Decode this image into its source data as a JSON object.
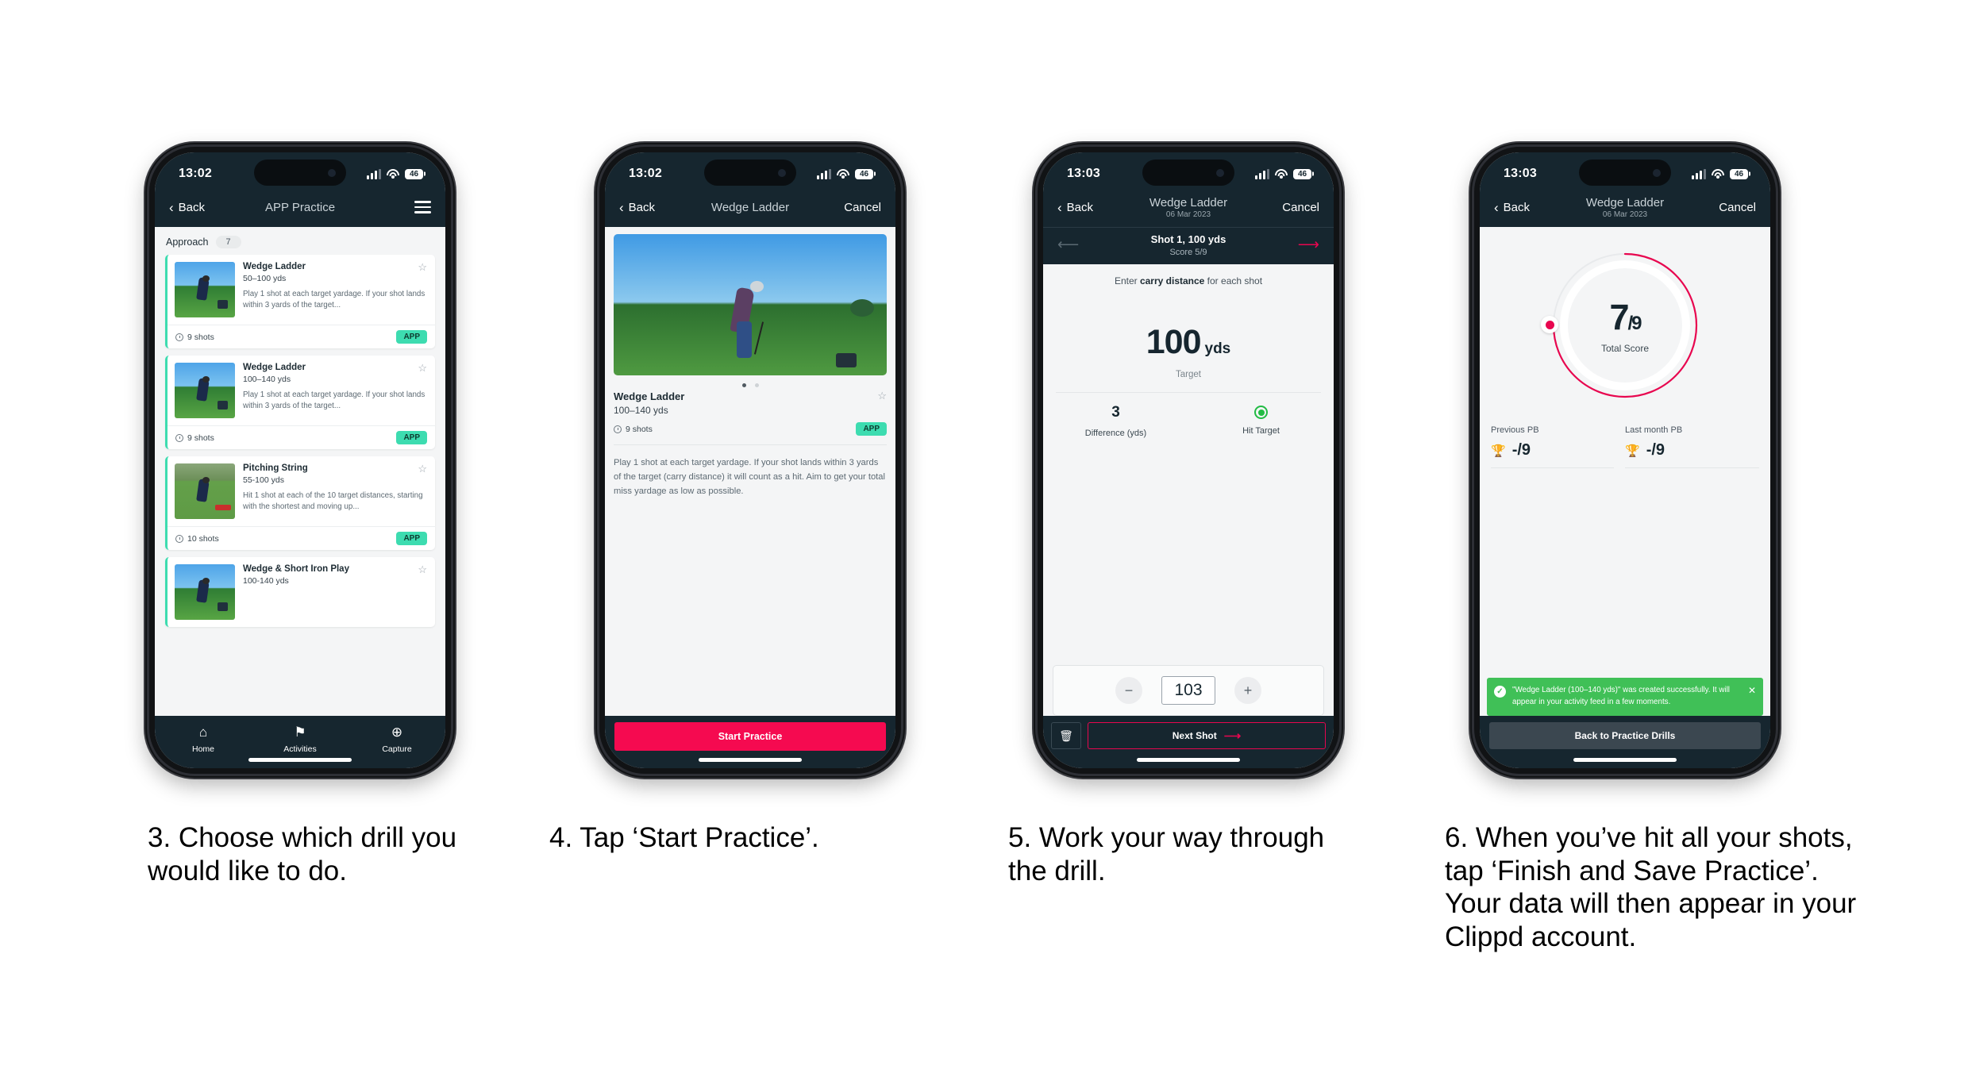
{
  "phones": [
    {
      "status": {
        "time": "13:02",
        "battery": "46"
      },
      "nav": {
        "back": "Back",
        "title": "APP Practice",
        "menu": "hamburger-icon"
      },
      "category": {
        "label": "Approach",
        "count": "7"
      },
      "drills": [
        {
          "title": "Wedge Ladder",
          "yardage": "50–100 yds",
          "description": "Play 1 shot at each target yardage. If your shot lands within 3 yards of the target...",
          "shots": "9 shots",
          "badge": "APP"
        },
        {
          "title": "Wedge Ladder",
          "yardage": "100–140 yds",
          "description": "Play 1 shot at each target yardage. If your shot lands within 3 yards of the target...",
          "shots": "9 shots",
          "badge": "APP"
        },
        {
          "title": "Pitching String",
          "yardage": "55-100 yds",
          "description": "Hit 1 shot at each of the 10 target distances, starting with the shortest and moving up...",
          "shots": "10 shots",
          "badge": "APP"
        },
        {
          "title": "Wedge & Short Iron Play",
          "yardage": "100-140 yds",
          "description": "",
          "shots": "",
          "badge": ""
        }
      ],
      "tabs": [
        {
          "label": "Home",
          "icon": "home-icon"
        },
        {
          "label": "Activities",
          "icon": "golf-flag-icon"
        },
        {
          "label": "Capture",
          "icon": "plus-circle-icon"
        }
      ]
    },
    {
      "status": {
        "time": "13:02",
        "battery": "46"
      },
      "nav": {
        "back": "Back",
        "title": "Wedge Ladder",
        "cancel": "Cancel"
      },
      "detail": {
        "title": "Wedge Ladder",
        "yardage": "100–140 yds",
        "shots": "9 shots",
        "badge": "APP",
        "description": "Play 1 shot at each target yardage. If your shot lands within 3 yards of the target (carry distance) it will count as a hit. Aim to get your total miss yardage as low as possible."
      },
      "cta": "Start Practice"
    },
    {
      "status": {
        "time": "13:03",
        "battery": "46"
      },
      "nav": {
        "back": "Back",
        "title": "Wedge Ladder",
        "subtitle": "06 Mar 2023",
        "cancel": "Cancel"
      },
      "shotbar": {
        "title": "Shot 1, 100 yds",
        "score": "Score 5/9"
      },
      "entry": {
        "hint_pre": "Enter ",
        "hint_bold": "carry distance",
        "hint_post": " for each shot",
        "target_value": "100",
        "target_unit": "yds",
        "target_label": "Target",
        "difference_value": "3",
        "difference_label": "Difference (yds)",
        "hit_label": "Hit Target",
        "stepper_value": "103",
        "minus": "−",
        "plus": "+"
      },
      "footer": {
        "delete": "trash-icon",
        "next": "Next Shot"
      }
    },
    {
      "status": {
        "time": "13:03",
        "battery": "46"
      },
      "nav": {
        "back": "Back",
        "title": "Wedge Ladder",
        "subtitle": "06 Mar 2023",
        "cancel": "Cancel"
      },
      "summary": {
        "score": "7",
        "score_total": "/9",
        "score_caption": "Total Score",
        "pbs": [
          {
            "label": "Previous PB",
            "value": "-/9"
          },
          {
            "label": "Last month PB",
            "value": "-/9"
          }
        ],
        "toast": "\"Wedge Ladder (100–140 yds)\" was created successfully. It will appear in your activity feed in a few moments.",
        "button": "Back to Practice Drills"
      }
    }
  ],
  "captions": [
    "3. Choose which drill you would like to do.",
    "4. Tap ‘Start Practice’.",
    "5. Work your way through the drill.",
    "6. When you’ve hit all your shots, tap ‘Finish and Save Practice’. Your data will then appear in your Clippd account."
  ],
  "colors": {
    "nav": "#16262f",
    "accent_pink": "#f50a50",
    "accent_teal": "#3ddcb0",
    "toast_green": "#40c057"
  }
}
